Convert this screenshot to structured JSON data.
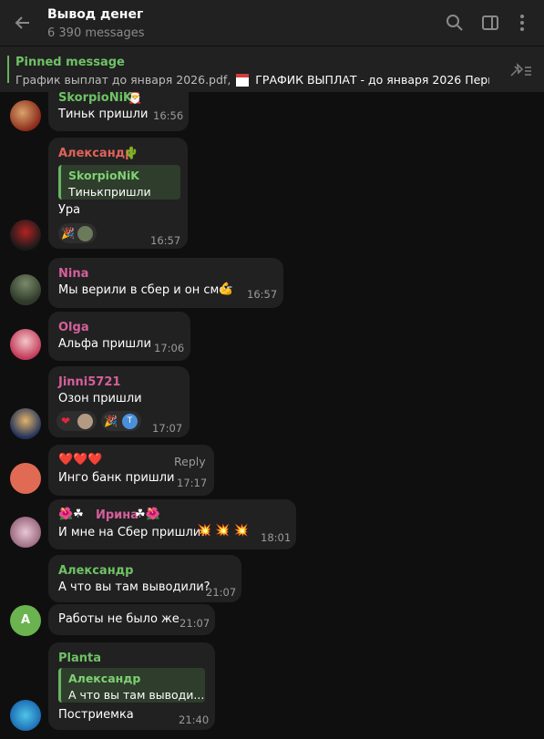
{
  "header": {
    "title": "Вывод денег",
    "subtitle": "6 390 messages"
  },
  "pinned": {
    "title": "Pinned message",
    "file": "График выплат до января 2026.pdf,",
    "text": "ГРАФИК ВЫПЛАТ - до января 2026  Период..."
  },
  "messages": [
    {
      "name": "SkorpioNiK",
      "text": "Тиньк пришли",
      "time": "16:56"
    },
    {
      "name": "Александр",
      "reply_name": "SkorpioNiK",
      "reply_text": "Тинькпришли",
      "text": "Ура",
      "time": "16:57"
    },
    {
      "name": "Nina",
      "text": "Мы верили в сбер и он смог",
      "time": "16:57"
    },
    {
      "name": "Olga",
      "text": "Альфа пришли",
      "time": "17:06"
    },
    {
      "name": "Jinni5721",
      "text": "Озон пришли",
      "time": "17:07",
      "react_label": "T"
    },
    {
      "name": "❤️❤️❤️",
      "text": "Инго банк пришли",
      "time": "17:17",
      "reply_label": "Reply"
    },
    {
      "name": "Ирина",
      "text": "И мне на Сбер пришли!",
      "time": "18:01"
    },
    {
      "name": "Александр",
      "text": "А что вы там выводили?",
      "time": "21:07",
      "avatar_letter": "A"
    },
    {
      "text": "Работы не было же",
      "time": "21:07"
    },
    {
      "name": "Planta",
      "reply_name": "Александр",
      "reply_text": "А что вы там выводи...",
      "text": "Постриемка",
      "time": "21:40"
    }
  ],
  "colors": {
    "green": "#6ec265",
    "red": "#e0625b",
    "pink": "#d65f9c"
  }
}
